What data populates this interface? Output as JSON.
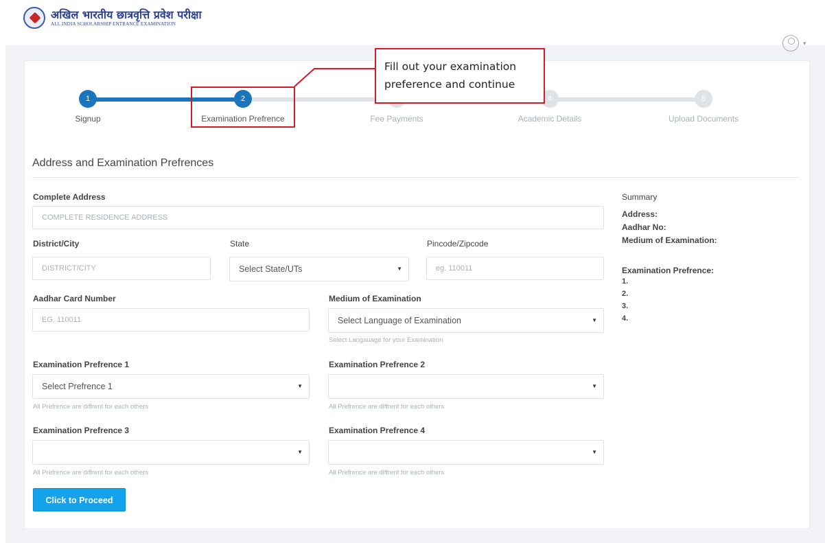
{
  "header": {
    "logo_hindi": "अखिल भारतीय छात्रवृत्ति प्रवेश परीक्षा",
    "logo_english": "ALL INDIA SCHOLARSHIP ENTRANCE EXAMINATION"
  },
  "stepper": {
    "steps": [
      {
        "num": "1",
        "label": "Signup",
        "status": "done"
      },
      {
        "num": "2",
        "label": "Examination Prefrence",
        "status": "active"
      },
      {
        "num": "3",
        "label": "Fee Payments",
        "status": "pending"
      },
      {
        "num": "4",
        "label": "Academic Details",
        "status": "pending"
      },
      {
        "num": "5",
        "label": "Upload Documents",
        "status": "pending"
      }
    ]
  },
  "callout": {
    "line1": "Fill out your examination",
    "line2": "preference and continue"
  },
  "form": {
    "section_title": "Address and Examination Prefrences",
    "address": {
      "label": "Complete Address",
      "placeholder": "COMPLETE RESIDENCE ADDRESS"
    },
    "district": {
      "label": "District/City",
      "placeholder": "DISTRICT/CITY"
    },
    "state": {
      "label": "State",
      "value": "Select State/UTs"
    },
    "pincode": {
      "label": "Pincode/Zipcode",
      "placeholder": "eg. 110011"
    },
    "aadhar": {
      "label": "Aadhar Card Number",
      "placeholder": "EG. 110011"
    },
    "medium": {
      "label": "Medium of Examination",
      "value": "Select Language of Examination",
      "help": "Select Langauage for your Examination"
    },
    "pref1": {
      "label": "Examination Prefrence 1",
      "value": "Select Prefrence 1",
      "help": "All Prefrence are diffrent for each others"
    },
    "pref2": {
      "label": "Examination Prefrence 2",
      "value": "",
      "help": "All Prefrence are diffrent for each others"
    },
    "pref3": {
      "label": "Examination Prefrence 3",
      "value": "",
      "help": "All Prefrence are diffrent for each others"
    },
    "pref4": {
      "label": "Examination Prefrence 4",
      "value": "",
      "help": "All Prefrence are diffrent for each others"
    },
    "submit_label": "Click to Proceed"
  },
  "summary": {
    "title": "Summary",
    "address": "Address:",
    "aadhar": "Aadhar No:",
    "medium": "Medium of Examination:",
    "pref_title": "Examination Prefrence:",
    "prefs": [
      "1.",
      "2.",
      "3.",
      "4."
    ]
  },
  "colors": {
    "primary": "#1b75bc",
    "button": "#14a2ec",
    "annotation": "#d7192a"
  }
}
